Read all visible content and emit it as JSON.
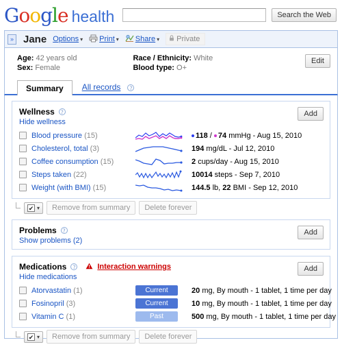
{
  "header": {
    "logo_google": "Google",
    "logo_product": "health",
    "search_value": "",
    "search_placeholder": "",
    "search_button": "Search the Web"
  },
  "profile": {
    "collapse_icon": "»",
    "user_name": "Jane",
    "options_label": "Options",
    "print_label": "Print",
    "share_label": "Share",
    "privacy_label": "Private",
    "caret": "▾"
  },
  "demographics": {
    "edit_button": "Edit",
    "left": [
      {
        "label": "Age:",
        "value": "42 years old"
      },
      {
        "label": "Sex:",
        "value": "Female"
      }
    ],
    "right": [
      {
        "label": "Race / Ethnicity:",
        "value": "White"
      },
      {
        "label": "Blood type:",
        "value": "O+"
      }
    ]
  },
  "tabs": [
    {
      "label": "Summary",
      "active": true
    },
    {
      "label": "All records",
      "active": false
    }
  ],
  "wellness": {
    "title": "Wellness",
    "toggle_link": "Hide wellness",
    "add_button": "Add",
    "rows": [
      {
        "name": "Blood pressure",
        "count": "(15)",
        "measure_prefix": "",
        "measure": "118 / 74 mmHg - Aug 15, 2010",
        "value_1": "118",
        "value_2": "74",
        "unit": "mmHg",
        "date": "Aug 15, 2010"
      },
      {
        "name": "Cholesterol, total",
        "count": "(3)",
        "value_1": "194",
        "unit": "mg/dL",
        "date": "Jul 12, 2010"
      },
      {
        "name": "Coffee consumption",
        "count": "(15)",
        "value_1": "2",
        "unit": "cups/day",
        "date": "Aug 15, 2010"
      },
      {
        "name": "Steps taken",
        "count": "(22)",
        "value_1": "10014",
        "unit": "steps",
        "date": "Sep 7, 2010"
      },
      {
        "name": "Weight (with BMI)",
        "count": "(15)",
        "value_1": "144.5",
        "unit": "lb",
        "value_2": "22",
        "unit_2": "BMI",
        "date": "Sep 12, 2010"
      }
    ]
  },
  "toolbar": {
    "check_glyph": "✔",
    "caret": "▾",
    "remove_label": "Remove from summary",
    "delete_label": "Delete forever"
  },
  "problems": {
    "title": "Problems",
    "toggle_link": "Show problems (2)",
    "add_button": "Add"
  },
  "medications": {
    "title": "Medications",
    "warning_label": "Interaction warnings",
    "toggle_link": "Hide medications",
    "add_button": "Add",
    "rows": [
      {
        "name": "Atorvastatin",
        "count": "(1)",
        "status": "Current",
        "dose": "20",
        "detail": "mg, By mouth - 1 tablet, 1 time per day"
      },
      {
        "name": "Fosinopril",
        "count": "(3)",
        "status": "Current",
        "dose": "10",
        "detail": "mg, By mouth - 1 tablet, 1 time per day"
      },
      {
        "name": "Vitamin C",
        "count": "(1)",
        "status": "Past",
        "dose": "500",
        "detail": "mg, By mouth - 1 tablet, 1 time per day"
      }
    ]
  },
  "icons": {
    "help": "?",
    "printer": "printer-icon",
    "share": "share-icon",
    "lock": "lock-icon",
    "warning": "warning-triangle-icon"
  },
  "colors": {
    "link": "#1a55c4",
    "accent": "#3b6fd4",
    "warning": "#cc0000",
    "systolic_dot": "#2b3df0",
    "diastolic_dot": "#cc38cc",
    "badge_current": "#4b74d4",
    "badge_past": "#9dbaee"
  }
}
